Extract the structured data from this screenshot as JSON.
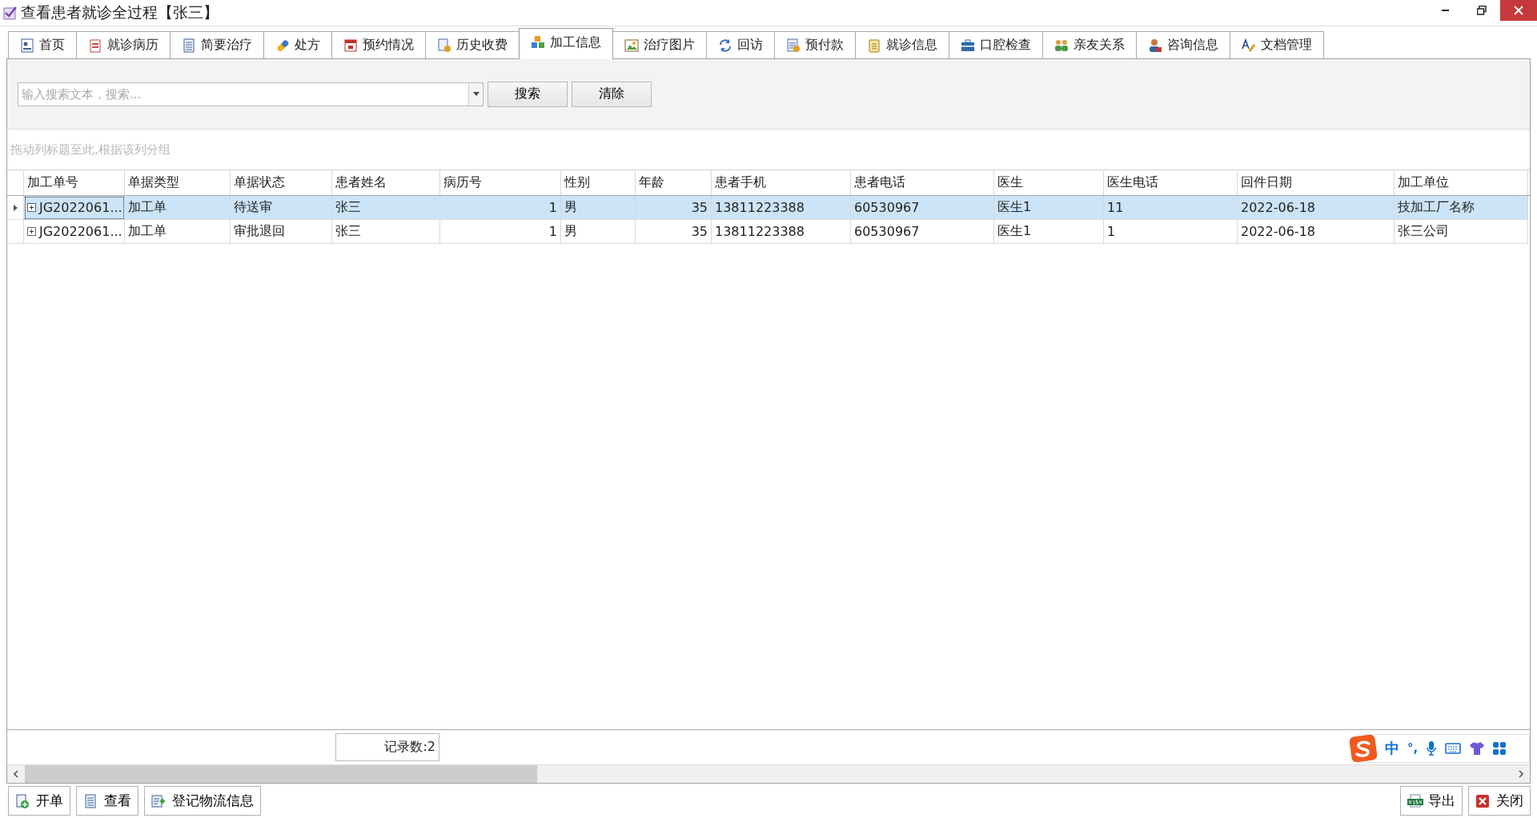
{
  "window": {
    "title": "查看患者就诊全过程【张三】"
  },
  "tabs": [
    {
      "label": "首页",
      "selected": false
    },
    {
      "label": "就诊病历",
      "selected": false
    },
    {
      "label": "简要治疗",
      "selected": false
    },
    {
      "label": "处方",
      "selected": false
    },
    {
      "label": "预约情况",
      "selected": false
    },
    {
      "label": "历史收费",
      "selected": false
    },
    {
      "label": "加工信息",
      "selected": true
    },
    {
      "label": "治疗图片",
      "selected": false
    },
    {
      "label": "回访",
      "selected": false
    },
    {
      "label": "预付款",
      "selected": false
    },
    {
      "label": "就诊信息",
      "selected": false
    },
    {
      "label": "口腔检查",
      "selected": false
    },
    {
      "label": "亲友关系",
      "selected": false
    },
    {
      "label": "咨询信息",
      "selected": false
    },
    {
      "label": "文档管理",
      "selected": false
    }
  ],
  "search": {
    "placeholder": "输入搜索文本，搜索...",
    "buttons": [
      "搜索",
      "清除"
    ]
  },
  "group_hint": "拖动列标题至此,根据该列分组",
  "table": {
    "columns": [
      "加工单号",
      "单据类型",
      "单据状态",
      "患者姓名",
      "病历号",
      "性别",
      "年龄",
      "患者手机",
      "患者电话",
      "医生",
      "医生电话",
      "回件日期",
      "加工单位"
    ],
    "rows": [
      {
        "selected": true,
        "cells": [
          "JG2022061...",
          "加工单",
          "待送审",
          "张三",
          "1",
          "男",
          "35",
          "13811223388",
          "60530967",
          "医生1",
          "11",
          "2022-06-18",
          "技加工厂名称"
        ]
      },
      {
        "selected": false,
        "cells": [
          "JG2022061...",
          "加工单",
          "审批退回",
          "张三",
          "1",
          "男",
          "35",
          "13811223388",
          "60530967",
          "医生1",
          "1",
          "2022-06-18",
          "张三公司"
        ]
      }
    ]
  },
  "footer": {
    "record_count": "记录数:2"
  },
  "ime": {
    "items": [
      "中",
      "°,"
    ]
  },
  "actions_left": [
    "开单",
    "查看",
    "登记物流信息"
  ],
  "actions_right": [
    "导出",
    "关闭"
  ]
}
